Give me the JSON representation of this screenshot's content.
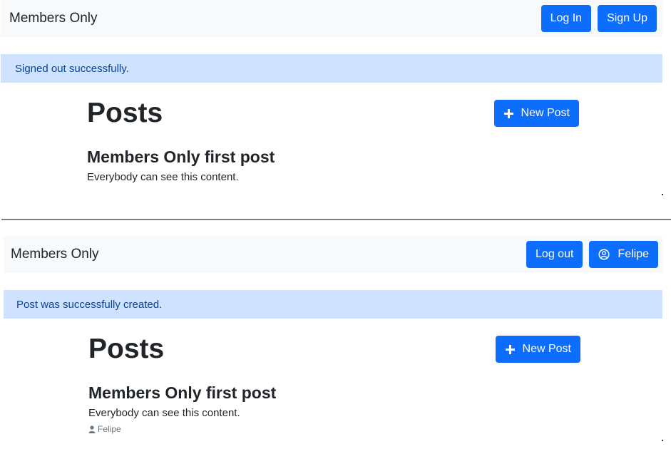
{
  "screen_top": {
    "navbar": {
      "brand": "Members Only",
      "login_label": "Log In",
      "signup_label": "Sign Up"
    },
    "alert": "Signed out successfully.",
    "posts": {
      "heading": "Posts",
      "new_post_label": "New Post",
      "items": [
        {
          "title": "Members Only first post",
          "body": "Everybody can see this content."
        }
      ]
    }
  },
  "screen_bottom": {
    "navbar": {
      "brand": "Members Only",
      "logout_label": "Log out",
      "user_label": "Felipe"
    },
    "alert": "Post was successfully created.",
    "posts": {
      "heading": "Posts",
      "new_post_label": "New Post",
      "items": [
        {
          "title": "Members Only first post",
          "body": "Everybody can see this content.",
          "author": "Felipe"
        }
      ]
    }
  },
  "icons": {
    "plus": "plus-icon",
    "user_circle": "user-circle-icon",
    "user": "user-icon"
  },
  "colors": {
    "primary": "#0d6efd",
    "alert_bg": "#cfe2ff",
    "alert_text": "#084298",
    "navbar_bg": "#f8f9fa"
  }
}
